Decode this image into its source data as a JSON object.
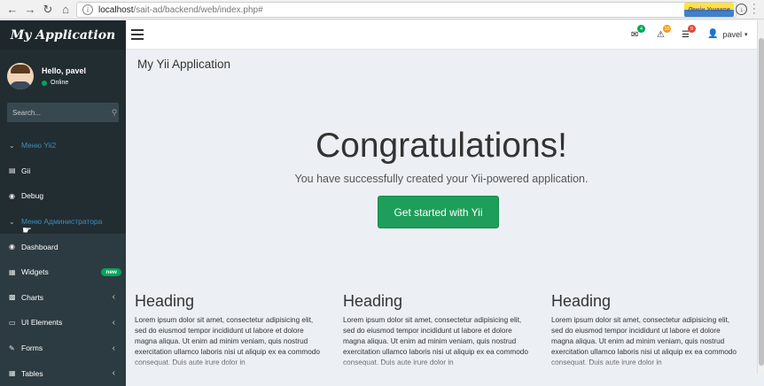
{
  "browser": {
    "url_host": "localhost",
    "url_path": "/sait-ad/backend/web/index.php#",
    "ext_label": "Ленін Ушаков"
  },
  "app": {
    "title": "My Application"
  },
  "user": {
    "greeting": "Hello, pavel",
    "status": "Online",
    "name": "pavel"
  },
  "search": {
    "placeholder": "Search..."
  },
  "menu": [
    {
      "label": "Меню Yii2",
      "icon": "chevron-down-icon"
    },
    {
      "label": "Gii",
      "icon": "file-code-icon"
    },
    {
      "label": "Debug",
      "icon": "dashboard-icon"
    },
    {
      "label": "Меню Администратора",
      "icon": "chevron-down-icon"
    },
    {
      "label": "Dashboard",
      "icon": "dashboard-icon"
    },
    {
      "label": "Widgets",
      "icon": "th-icon",
      "badge": "new"
    },
    {
      "label": "Charts",
      "icon": "bar-chart-icon"
    },
    {
      "label": "UI Elements",
      "icon": "laptop-icon"
    },
    {
      "label": "Forms",
      "icon": "edit-icon"
    },
    {
      "label": "Tables",
      "icon": "table-icon"
    }
  ],
  "topbar": {
    "messages_count": "4",
    "notifications_count": "10",
    "tasks_count": "9"
  },
  "content": {
    "page_title": "My Yii Application",
    "jumbo_title": "Congratulations!",
    "jumbo_lead": "You have successfully created your Yii-powered application.",
    "cta_label": "Get started with Yii",
    "columns": [
      {
        "heading": "Heading",
        "text": "Lorem ipsum dolor sit amet, consectetur adipisicing elit, sed do eiusmod tempor incididunt ut labore et dolore magna aliqua. Ut enim ad minim veniam, quis nostrud exercitation ullamco laboris nisi ut aliquip ex ea commodo consequat. Duis aute irure dolor in"
      },
      {
        "heading": "Heading",
        "text": "Lorem ipsum dolor sit amet, consectetur adipisicing elit, sed do eiusmod tempor incididunt ut labore et dolore magna aliqua. Ut enim ad minim veniam, quis nostrud exercitation ullamco laboris nisi ut aliquip ex ea commodo consequat. Duis aute irure dolor in"
      },
      {
        "heading": "Heading",
        "text": "Lorem ipsum dolor sit amet, consectetur adipisicing elit, sed do eiusmod tempor incididunt ut labore et dolore magna aliqua. Ut enim ad minim veniam, quis nostrud exercitation ullamco laboris nisi ut aliquip ex ea commodo consequat. Duis aute irure dolor in"
      }
    ]
  },
  "colors": {
    "sidebar_bg": "#222d32",
    "sidebar_link_blue": "#3c8dbc",
    "online_green": "#00a65a",
    "cta_green": "#1e9e5a",
    "badge_green": "#00a65a",
    "badge_yellow": "#f39c12",
    "badge_red": "#dd4b39"
  }
}
